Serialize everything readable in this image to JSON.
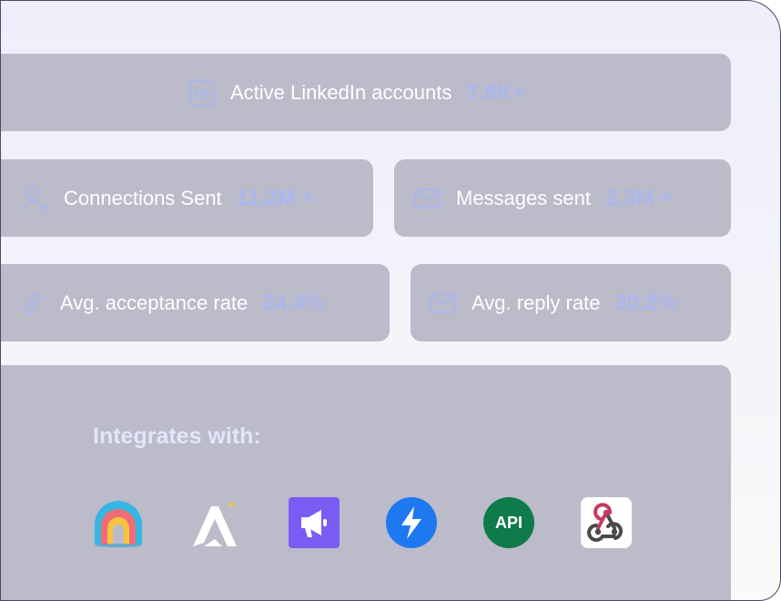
{
  "stats": {
    "linkedin": {
      "label": "Active LinkedIn accounts",
      "value": "7.6K+",
      "icon": "linkedin-icon"
    },
    "connections": {
      "label": "Connections Sent",
      "value": "11.2M +",
      "icon": "user-plus-icon"
    },
    "messages": {
      "label": "Messages sent",
      "value": "2.3M +",
      "icon": "mail-icon"
    },
    "acceptance": {
      "label": "Avg. acceptance rate",
      "value": "24.4%",
      "icon": "link-icon"
    },
    "reply": {
      "label": "Avg. reply rate",
      "value": "20.2%",
      "icon": "mail-icon"
    }
  },
  "integrations": {
    "title": "Integrates with:",
    "items": [
      {
        "name": "rainbow-logo-icon"
      },
      {
        "name": "a-logo-icon"
      },
      {
        "name": "megaphone-logo-icon"
      },
      {
        "name": "lightning-logo-icon"
      },
      {
        "name": "api-logo-icon",
        "text": "API"
      },
      {
        "name": "webhook-logo-icon"
      }
    ]
  },
  "colors": {
    "card": "#bbbbca",
    "value_accent": "#a9b7ee",
    "title": "#e3e6f9"
  }
}
